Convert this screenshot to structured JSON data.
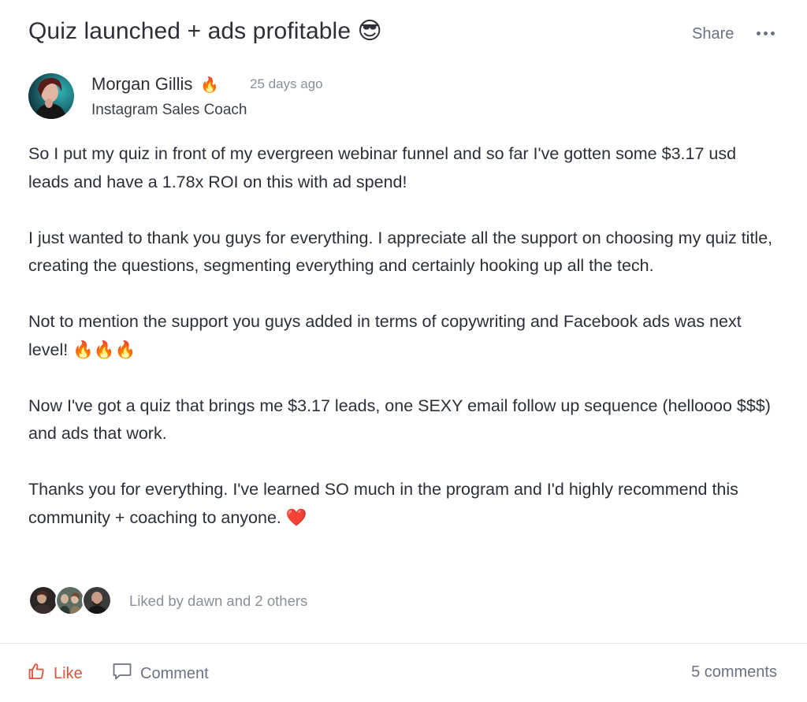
{
  "post": {
    "title": "Quiz launched + ads profitable 😎",
    "share_label": "Share",
    "author": {
      "name": "Morgan Gillis",
      "badge": "🔥",
      "time": "25 days ago",
      "role": "Instagram Sales Coach"
    },
    "paragraphs": [
      "So I put my quiz in front of my evergreen webinar funnel and so far I've gotten some $3.17 usd leads and have a 1.78x ROI on this with ad spend!",
      "I just wanted to thank you guys for everything. I appreciate all the support on choosing my quiz title, creating the questions, segmenting everything and certainly hooking up all the tech.",
      "Not to mention the support you guys added in terms of copywriting and Facebook ads was next level! 🔥🔥🔥",
      "Now I've got a quiz that brings me $3.17 leads, one SEXY email follow up sequence (helloooo $$$) and ads that work.",
      "Thanks you for everything. I've learned SO much in the program and I'd highly recommend this community + coaching to anyone. ❤️"
    ],
    "liked_by": "Liked by dawn and 2 others"
  },
  "actions": {
    "like_label": "Like",
    "comment_label": "Comment",
    "comments_count": "5 comments"
  },
  "colors": {
    "like_accent": "#e0533b",
    "muted": "#6b7280"
  }
}
